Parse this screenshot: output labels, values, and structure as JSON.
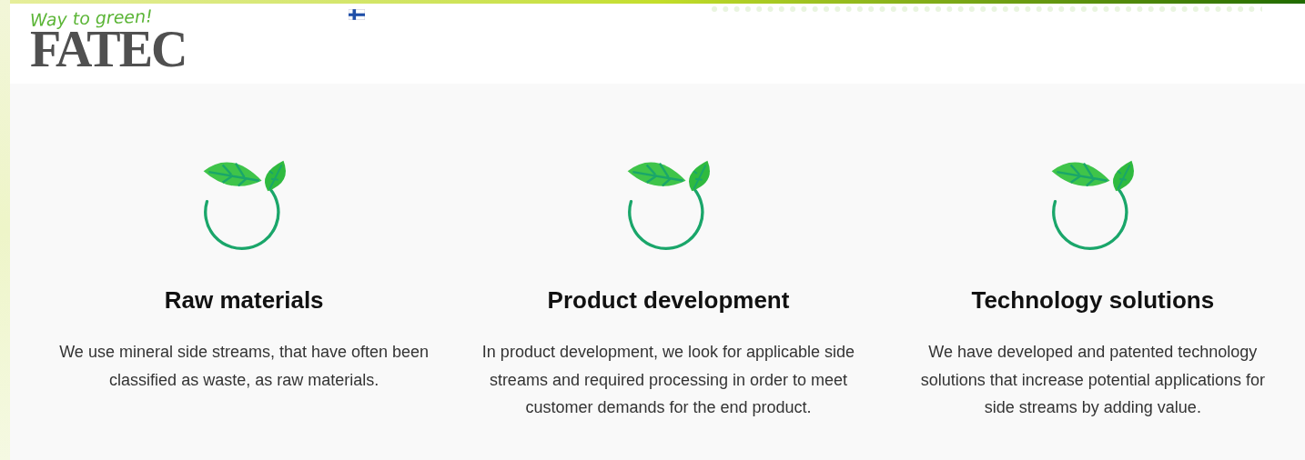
{
  "header": {
    "tagline": "Way to green!",
    "logo": "FATEC"
  },
  "features": [
    {
      "title": "Raw materials",
      "text": "We use mineral side streams, that have often been classified as waste, as raw materials."
    },
    {
      "title": "Product development",
      "text": "In product development, we look for applicable side streams and required processing in order to meet customer demands for the end product."
    },
    {
      "title": "Technology solutions",
      "text": "We have developed and patented technology solutions that increase potential applications for  side streams by adding value."
    }
  ]
}
